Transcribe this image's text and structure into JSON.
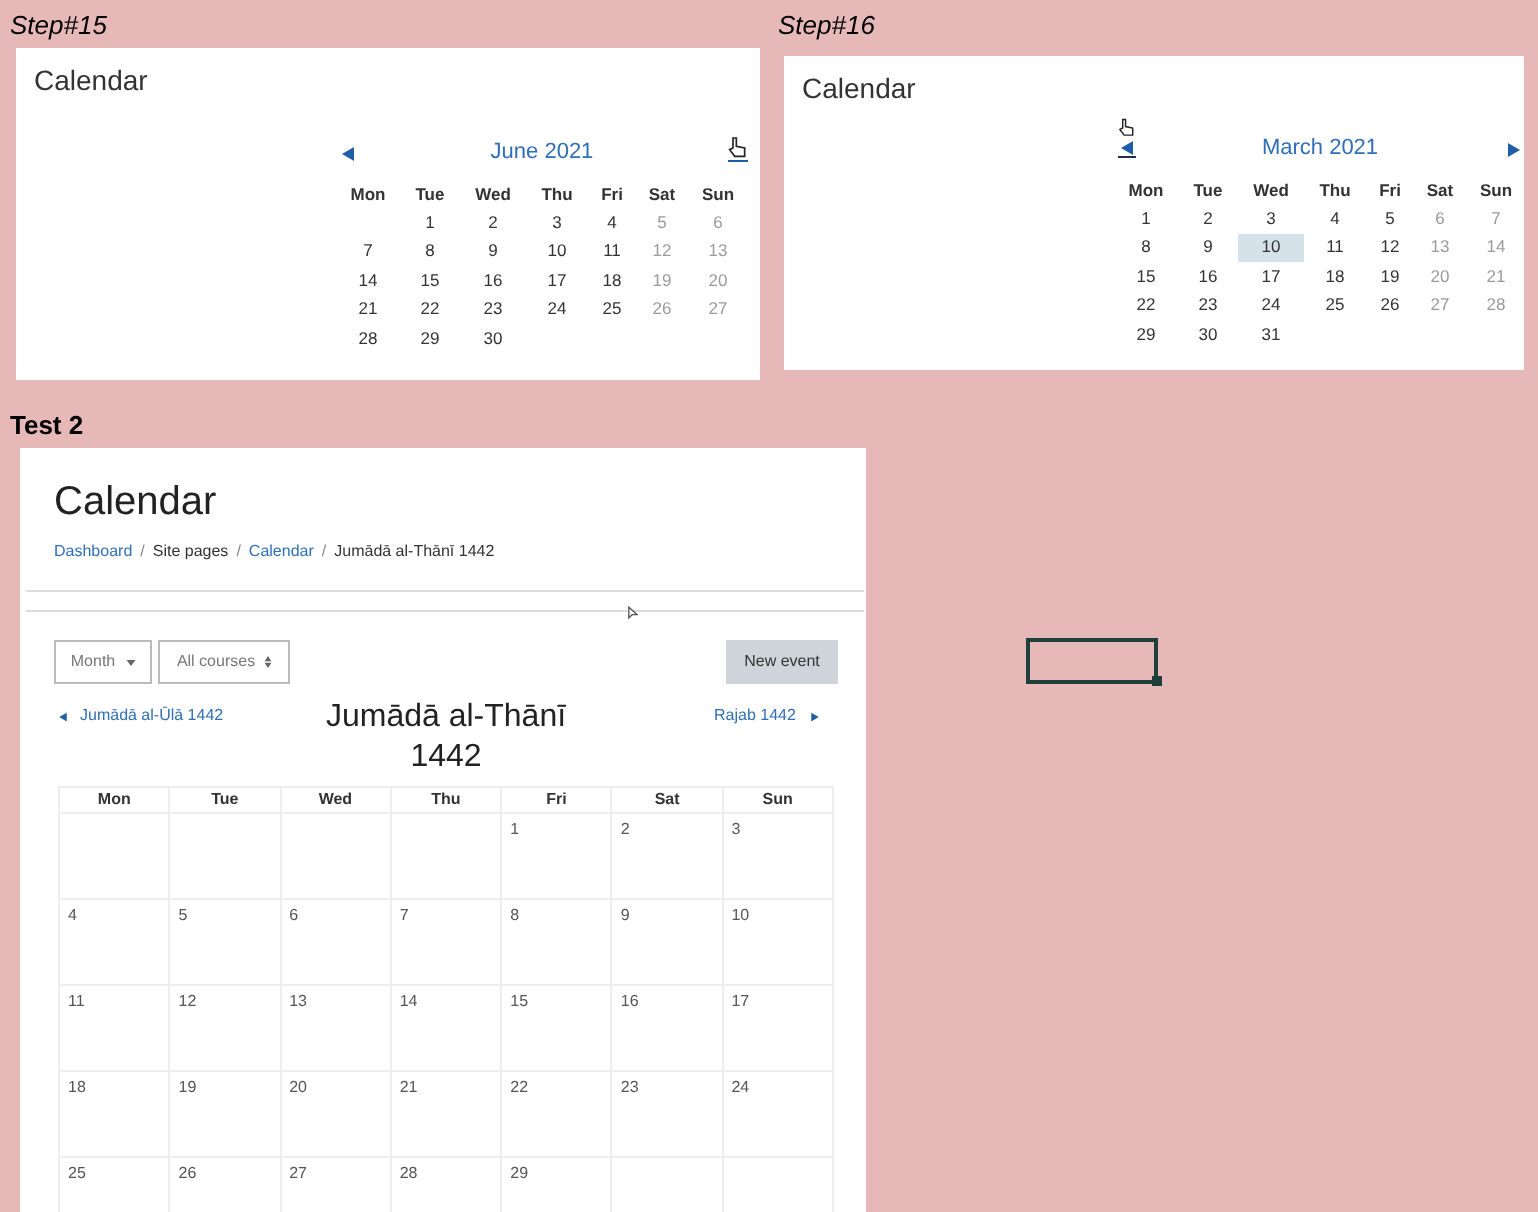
{
  "snapshots": [
    {
      "label": "Step#15",
      "title": "Calendar",
      "month": "June 2021",
      "prev_hovered": false,
      "next_hovered": true,
      "weekdays": [
        "Mon",
        "Tue",
        "Wed",
        "Thu",
        "Fri",
        "Sat",
        "Sun"
      ],
      "weeks": [
        [
          {
            "kind": "empty"
          },
          {
            "kind": "day",
            "label": "1",
            "selected": false
          },
          {
            "kind": "day",
            "label": "2",
            "selected": false
          },
          {
            "kind": "day",
            "label": "3",
            "selected": false
          },
          {
            "kind": "day",
            "label": "4",
            "selected": false
          },
          {
            "kind": "day",
            "label": "5",
            "selected": false
          },
          {
            "kind": "day",
            "label": "6",
            "selected": false
          }
        ],
        [
          {
            "kind": "day",
            "label": "7",
            "selected": false
          },
          {
            "kind": "day",
            "label": "8",
            "selected": false
          },
          {
            "kind": "day",
            "label": "9",
            "selected": false
          },
          {
            "kind": "day",
            "label": "10",
            "selected": false
          },
          {
            "kind": "day",
            "label": "11",
            "selected": false
          },
          {
            "kind": "day",
            "label": "12",
            "selected": false
          },
          {
            "kind": "day",
            "label": "13",
            "selected": false
          }
        ],
        [
          {
            "kind": "day",
            "label": "14",
            "selected": false
          },
          {
            "kind": "day",
            "label": "15",
            "selected": false
          },
          {
            "kind": "day",
            "label": "16",
            "selected": false
          },
          {
            "kind": "day",
            "label": "17",
            "selected": false
          },
          {
            "kind": "day",
            "label": "18",
            "selected": false
          },
          {
            "kind": "day",
            "label": "19",
            "selected": false
          },
          {
            "kind": "day",
            "label": "20",
            "selected": false
          }
        ],
        [
          {
            "kind": "day",
            "label": "21",
            "selected": false
          },
          {
            "kind": "day",
            "label": "22",
            "selected": false
          },
          {
            "kind": "day",
            "label": "23",
            "selected": false
          },
          {
            "kind": "day",
            "label": "24",
            "selected": false
          },
          {
            "kind": "day",
            "label": "25",
            "selected": false
          },
          {
            "kind": "day",
            "label": "26",
            "selected": false
          },
          {
            "kind": "day",
            "label": "27",
            "selected": false
          }
        ],
        [
          {
            "kind": "day",
            "label": "28",
            "selected": false
          },
          {
            "kind": "day",
            "label": "29",
            "selected": false
          },
          {
            "kind": "day",
            "label": "30",
            "selected": false
          }
        ]
      ]
    },
    {
      "label": "Step#16",
      "title": "Calendar",
      "month": "March 2021",
      "prev_hovered": true,
      "next_hovered": false,
      "weekdays": [
        "Mon",
        "Tue",
        "Wed",
        "Thu",
        "Fri",
        "Sat",
        "Sun"
      ],
      "weeks": [
        [
          {
            "kind": "day",
            "label": "1",
            "selected": false
          },
          {
            "kind": "day",
            "label": "2",
            "selected": false
          },
          {
            "kind": "day",
            "label": "3",
            "selected": false
          },
          {
            "kind": "day",
            "label": "4",
            "selected": false
          },
          {
            "kind": "day",
            "label": "5",
            "selected": false
          },
          {
            "kind": "day",
            "label": "6",
            "selected": false
          },
          {
            "kind": "day",
            "label": "7",
            "selected": false
          }
        ],
        [
          {
            "kind": "day",
            "label": "8",
            "selected": false
          },
          {
            "kind": "day",
            "label": "9",
            "selected": false
          },
          {
            "kind": "day",
            "label": "10",
            "selected": true
          },
          {
            "kind": "day",
            "label": "11",
            "selected": false
          },
          {
            "kind": "day",
            "label": "12",
            "selected": false
          },
          {
            "kind": "day",
            "label": "13",
            "selected": false
          },
          {
            "kind": "day",
            "label": "14",
            "selected": false
          }
        ],
        [
          {
            "kind": "day",
            "label": "15",
            "selected": false
          },
          {
            "kind": "day",
            "label": "16",
            "selected": false
          },
          {
            "kind": "day",
            "label": "17",
            "selected": false
          },
          {
            "kind": "day",
            "label": "18",
            "selected": false
          },
          {
            "kind": "day",
            "label": "19",
            "selected": false
          },
          {
            "kind": "day",
            "label": "20",
            "selected": false
          },
          {
            "kind": "day",
            "label": "21",
            "selected": false
          }
        ],
        [
          {
            "kind": "day",
            "label": "22",
            "selected": false
          },
          {
            "kind": "day",
            "label": "23",
            "selected": false
          },
          {
            "kind": "day",
            "label": "24",
            "selected": false
          },
          {
            "kind": "day",
            "label": "25",
            "selected": false
          },
          {
            "kind": "day",
            "label": "26",
            "selected": false
          },
          {
            "kind": "day",
            "label": "27",
            "selected": false
          },
          {
            "kind": "day",
            "label": "28",
            "selected": false
          }
        ],
        [
          {
            "kind": "day",
            "label": "29",
            "selected": false
          },
          {
            "kind": "day",
            "label": "30",
            "selected": false
          },
          {
            "kind": "day",
            "label": "31",
            "selected": false
          }
        ]
      ]
    }
  ],
  "test": {
    "label": "Test 2",
    "title": "Calendar",
    "breadcrumb": [
      {
        "kind": "link",
        "text": "Dashboard"
      },
      {
        "kind": "separator",
        "text": "/"
      },
      {
        "kind": "text",
        "text": "Site pages"
      },
      {
        "kind": "separator",
        "text": "/"
      },
      {
        "kind": "link",
        "text": "Calendar"
      },
      {
        "kind": "separator",
        "text": "/"
      },
      {
        "kind": "text",
        "text": "Jumādā al-Thānī 1442"
      }
    ],
    "view_select": "Month",
    "course_select": "All courses",
    "new_event": "New event",
    "prev_month": "Jumādā al-Ūlā 1442",
    "month_title": "Jumādā al-Thānī 1442",
    "next_month": "Rajab 1442",
    "weekdays": [
      "Mon",
      "Tue",
      "Wed",
      "Thu",
      "Fri",
      "Sat",
      "Sun"
    ],
    "weeks": [
      [
        {
          "kind": "empty"
        },
        {
          "kind": "empty"
        },
        {
          "kind": "empty"
        },
        {
          "kind": "empty"
        },
        {
          "kind": "day",
          "label": "1"
        },
        {
          "kind": "day",
          "label": "2"
        },
        {
          "kind": "day",
          "label": "3"
        }
      ],
      [
        {
          "kind": "day",
          "label": "4"
        },
        {
          "kind": "day",
          "label": "5"
        },
        {
          "kind": "day",
          "label": "6"
        },
        {
          "kind": "day",
          "label": "7"
        },
        {
          "kind": "day",
          "label": "8"
        },
        {
          "kind": "day",
          "label": "9"
        },
        {
          "kind": "day",
          "label": "10"
        }
      ],
      [
        {
          "kind": "day",
          "label": "11"
        },
        {
          "kind": "day",
          "label": "12"
        },
        {
          "kind": "day",
          "label": "13"
        },
        {
          "kind": "day",
          "label": "14"
        },
        {
          "kind": "day",
          "label": "15"
        },
        {
          "kind": "day",
          "label": "16"
        },
        {
          "kind": "day",
          "label": "17"
        }
      ],
      [
        {
          "kind": "day",
          "label": "18"
        },
        {
          "kind": "day",
          "label": "19"
        },
        {
          "kind": "day",
          "label": "20"
        },
        {
          "kind": "day",
          "label": "21"
        },
        {
          "kind": "day",
          "label": "22"
        },
        {
          "kind": "day",
          "label": "23"
        },
        {
          "kind": "day",
          "label": "24"
        }
      ],
      [
        {
          "kind": "day",
          "label": "25"
        },
        {
          "kind": "day",
          "label": "26"
        },
        {
          "kind": "day",
          "label": "27"
        },
        {
          "kind": "day",
          "label": "28"
        },
        {
          "kind": "day",
          "label": "29"
        }
      ]
    ]
  }
}
